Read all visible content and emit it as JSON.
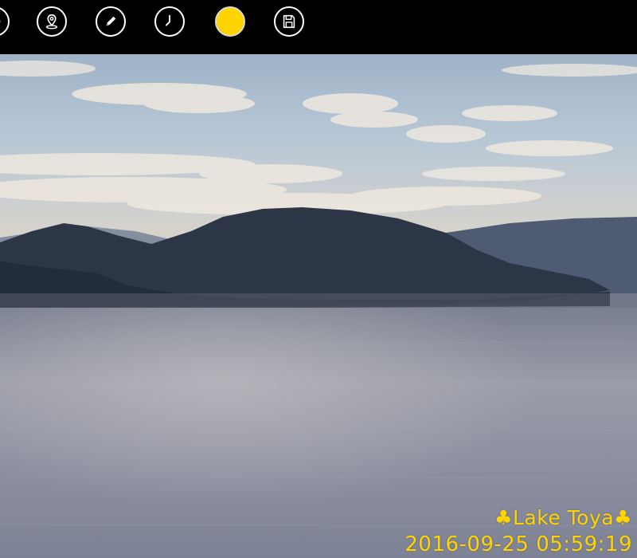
{
  "toolbar": {
    "tools": [
      {
        "id": "partial-left",
        "icon": "circle-icon"
      },
      {
        "id": "location",
        "icon": "map-pin-icon"
      },
      {
        "id": "edit",
        "icon": "pencil-icon"
      },
      {
        "id": "time",
        "icon": "clock-icon"
      },
      {
        "id": "color",
        "icon": "color-swatch",
        "color": "#ffd400"
      },
      {
        "id": "save",
        "icon": "floppy-disk-icon"
      }
    ]
  },
  "photo": {
    "caption": {
      "title": "♣Lake Toya♣",
      "datetime": "2016-09-25 05:59:19",
      "text_color": "#ffd400"
    }
  },
  "colors": {
    "toolbar_bg": "#000000",
    "icon": "#ffffff",
    "accent": "#ffd400"
  }
}
